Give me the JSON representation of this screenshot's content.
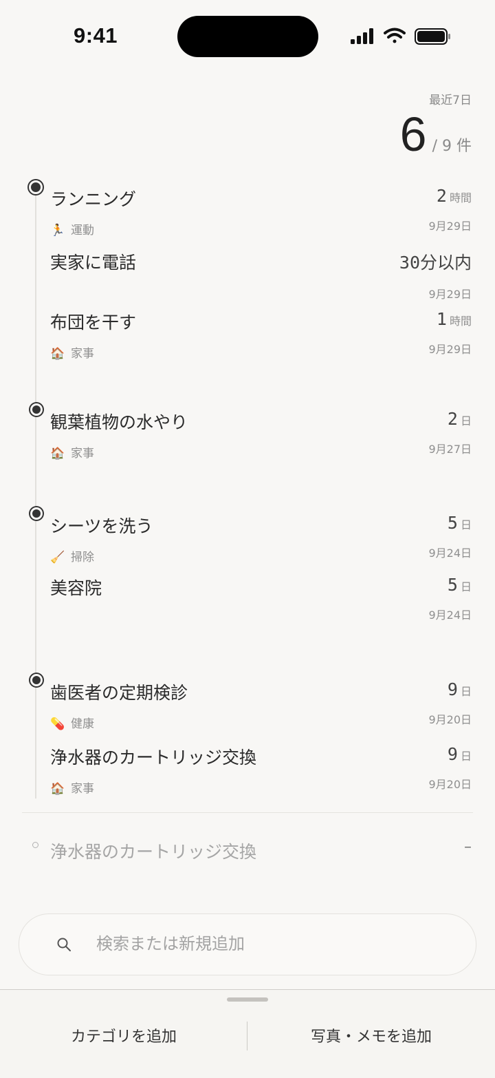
{
  "status_bar": {
    "time": "9:41"
  },
  "summary": {
    "label": "最近7日",
    "count": "6",
    "total": "/ 9 件"
  },
  "tasks": [
    {
      "name": "ランニング",
      "duration": "2",
      "unit": "時間",
      "category_icon": "🏃",
      "category": "運動",
      "date": "9月29日"
    },
    {
      "name": "実家に電話",
      "duration": "30分以内",
      "unit": "",
      "category_icon": "",
      "category": "",
      "date": "9月29日"
    },
    {
      "name": "布団を干す",
      "duration": "1",
      "unit": "時間",
      "category_icon": "🏠",
      "category": "家事",
      "date": "9月29日"
    },
    {
      "name": "観葉植物の水やり",
      "duration": "2",
      "unit": "日",
      "category_icon": "🏠",
      "category": "家事",
      "date": "9月27日"
    },
    {
      "name": "シーツを洗う",
      "duration": "5",
      "unit": "日",
      "category_icon": "🧹",
      "category": "掃除",
      "date": "9月24日"
    },
    {
      "name": "美容院",
      "duration": "5",
      "unit": "日",
      "category_icon": "",
      "category": "",
      "date": "9月24日"
    },
    {
      "name": "歯医者の定期検診",
      "duration": "9",
      "unit": "日",
      "category_icon": "💊",
      "category": "健康",
      "date": "9月20日"
    },
    {
      "name": "浄水器のカートリッジ交換",
      "duration": "9",
      "unit": "日",
      "category_icon": "🏠",
      "category": "家事",
      "date": "9月20日"
    }
  ],
  "pending": {
    "name": "浄水器のカートリッジ交換",
    "value": "–"
  },
  "search": {
    "placeholder": "検索または新規追加"
  },
  "bottom_sheet": {
    "add_category": "カテゴリを追加",
    "add_photo_memo": "写真・メモを追加"
  }
}
